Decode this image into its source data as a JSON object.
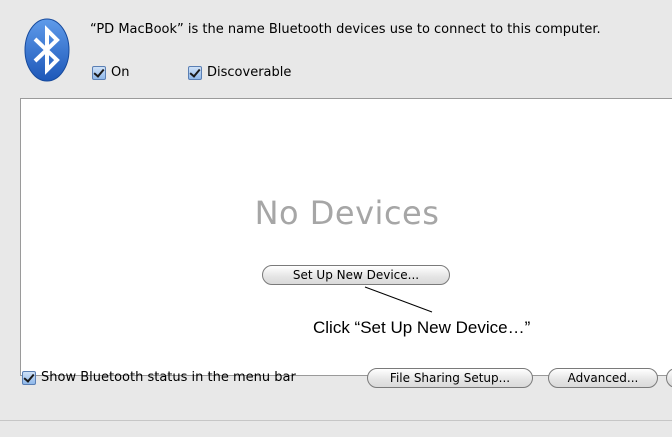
{
  "header": {
    "description": "“PD MacBook” is the name Bluetooth devices use to connect to this computer.",
    "bluetooth_logo": "bluetooth-icon",
    "on_label": "On",
    "on_checked": true,
    "discoverable_label": "Discoverable",
    "discoverable_checked": true
  },
  "device_list": {
    "empty_message": "No Devices",
    "setup_button_label": "Set Up New Device..."
  },
  "annotation": {
    "text": "Click “Set Up New Device…”"
  },
  "footer": {
    "show_status_label": "Show Bluetooth status in the menu bar",
    "show_status_checked": true,
    "file_sharing_label": "File Sharing Setup...",
    "advanced_label": "Advanced..."
  },
  "colors": {
    "bluetooth_blue": "#2b6fd6",
    "pane_background": "#e8e8e8",
    "empty_text": "#a6a6a6"
  }
}
